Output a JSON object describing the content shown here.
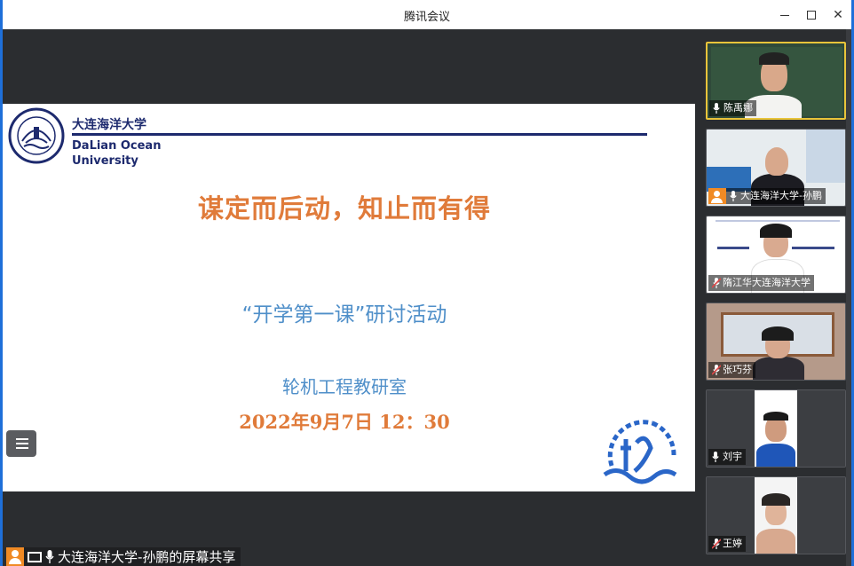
{
  "window": {
    "title": "腾讯会议",
    "minimize_glyph": "—",
    "maximize_glyph": "□",
    "close_glyph": "✕"
  },
  "slide": {
    "university_cn": "大连海洋大学",
    "university_en_line1": "DaLian Ocean",
    "university_en_line2": "University",
    "slogan": "谋定而后动，知止而有得",
    "event": "“开学第一课”研讨活动",
    "department": "轮机工程教研室",
    "datetime": "2022年9月7日   12：30"
  },
  "share_caption": {
    "text": "大连海洋大学-孙鹏的屏幕共享",
    "icons": [
      "user-icon",
      "screen-share-icon",
      "microphone-icon"
    ]
  },
  "participants": [
    {
      "name": "陈禹娜",
      "mic": "on",
      "active_speaker": true
    },
    {
      "name": "大连海洋大学-孙鹏",
      "mic": "on",
      "host": true
    },
    {
      "name": "隋江华大连海洋大学",
      "mic": "muted"
    },
    {
      "name": "张巧芬",
      "mic": "muted"
    },
    {
      "name": "刘宇",
      "mic": "on"
    },
    {
      "name": "王婷",
      "mic": "muted"
    }
  ],
  "colors": {
    "accent_blue": "#1e6fd9",
    "slogan_orange": "#e07b3a",
    "event_blue": "#4f8fc9",
    "university_navy": "#1d2a6e",
    "host_badge_orange": "#f08a24",
    "active_speaker_yellow": "#e9c43a",
    "muted_red": "#e04848"
  }
}
